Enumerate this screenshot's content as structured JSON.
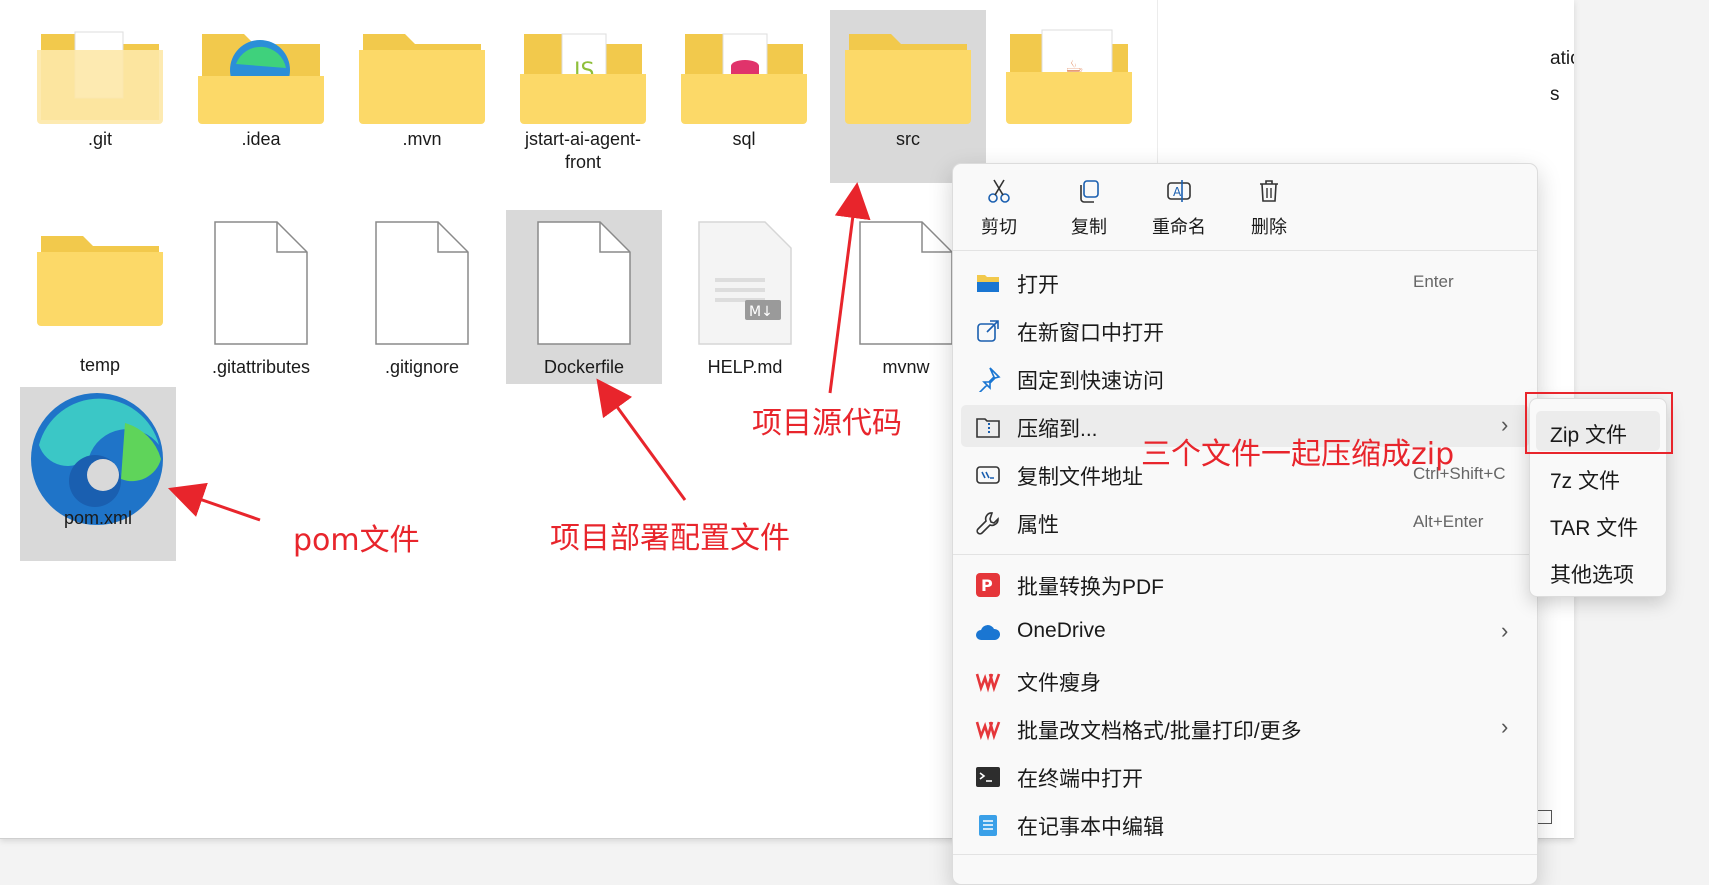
{
  "files": [
    {
      "name": ".git",
      "icon": "folder-with-document-icon"
    },
    {
      "name": ".idea",
      "icon": "folder-with-edge-icon"
    },
    {
      "name": ".mvn",
      "icon": "folder-icon"
    },
    {
      "name": "jstart-ai-agent-front",
      "icon": "folder-with-js-icon"
    },
    {
      "name": "sql",
      "icon": "folder-with-database-icon"
    },
    {
      "name": "src",
      "icon": "folder-icon",
      "selected": true
    },
    {
      "name": "",
      "icon": "folder-with-java-icon"
    },
    {
      "name": "temp",
      "icon": "folder-icon"
    },
    {
      "name": ".gitattributes",
      "icon": "blank-file-icon"
    },
    {
      "name": ".gitignore",
      "icon": "blank-file-icon"
    },
    {
      "name": "Dockerfile",
      "icon": "blank-file-icon",
      "selected": true
    },
    {
      "name": "HELP.md",
      "icon": "markdown-file-icon"
    },
    {
      "name": "mvnw",
      "icon": "blank-file-icon"
    },
    {
      "name": "pom.xml",
      "icon": "edge-file-icon",
      "selected": true
    }
  ],
  "details_pane": {
    "line1": "ation_memory",
    "line2": "s"
  },
  "annotations": {
    "src": "项目源代码",
    "dockerfile": "项目部署配置文件",
    "pom": "pom文件",
    "zip": "三个文件一起压缩成zip",
    "color": "#e8252c"
  },
  "context_menu": {
    "quick_actions": [
      {
        "label": "剪切",
        "icon": "scissors-icon"
      },
      {
        "label": "复制",
        "icon": "copy-icon"
      },
      {
        "label": "重命名",
        "icon": "rename-icon"
      },
      {
        "label": "删除",
        "icon": "trash-icon"
      }
    ],
    "items": [
      {
        "label": "打开",
        "shortcut": "Enter",
        "icon": "folder-open-icon"
      },
      {
        "label": "在新窗口中打开",
        "shortcut": "",
        "icon": "new-window-icon"
      },
      {
        "label": "固定到快速访问",
        "shortcut": "",
        "icon": "pin-icon"
      },
      {
        "label": "压缩到...",
        "shortcut": "",
        "icon": "zip-folder-icon",
        "submenu": true
      },
      {
        "label": "复制文件地址",
        "shortcut": "Ctrl+Shift+C",
        "icon": "copy-path-icon"
      },
      {
        "label": "属性",
        "shortcut": "Alt+Enter",
        "icon": "wrench-icon"
      },
      {
        "label": "批量转换为PDF",
        "shortcut": "",
        "icon": "pdf-convert-icon"
      },
      {
        "label": "OneDrive",
        "shortcut": "",
        "icon": "onedrive-cloud-icon",
        "submenu": true
      },
      {
        "label": "文件瘦身",
        "shortcut": "",
        "icon": "wps-icon"
      },
      {
        "label": "批量改文档格式/批量打印/更多",
        "shortcut": "",
        "icon": "wps-icon",
        "submenu": true
      },
      {
        "label": "在终端中打开",
        "shortcut": "",
        "icon": "terminal-icon"
      },
      {
        "label": "在记事本中编辑",
        "shortcut": "",
        "icon": "notepad-icon"
      }
    ]
  },
  "submenu": {
    "items": [
      "Zip 文件",
      "7z 文件",
      "TAR 文件",
      "其他选项"
    ]
  }
}
